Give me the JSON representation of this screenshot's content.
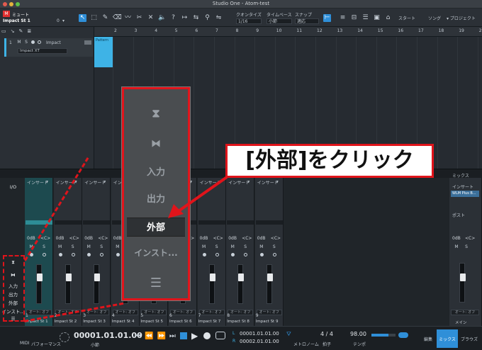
{
  "window": {
    "title": "Studio One - Atom-test"
  },
  "toolbar": {
    "mute_label": "ミュート",
    "track_label": "Impact St 1",
    "track_counter": "0",
    "quantize_label": "クオンタイズ",
    "quantize_value": "1/16",
    "timebase_label": "タイムベース",
    "timebase_value": "小節",
    "snap_label": "スナップ",
    "snap_value": "適応",
    "start_label": "スタート",
    "song_label": "ソング",
    "project_label": "プロジェクト"
  },
  "arrange": {
    "ruler": [
      "2",
      "3",
      "4",
      "5",
      "6",
      "7",
      "8",
      "9",
      "10",
      "11",
      "12",
      "13",
      "14",
      "15",
      "16",
      "17",
      "18",
      "19",
      "20"
    ],
    "track": {
      "number": "1",
      "m": "M",
      "s": "S",
      "name": "Impact",
      "instrument": "Impact XT"
    },
    "pattern_label": "Pattern"
  },
  "leftpanel": {
    "io": "I/O",
    "items": [
      "入力",
      "出力",
      "外部",
      "インスト..."
    ]
  },
  "callout": {
    "items": [
      "入力",
      "出力",
      "外部",
      "インスト..."
    ],
    "label": "[外部]をクリック"
  },
  "mixer": {
    "strips": [
      {
        "insert": "インサート",
        "db": "0dB",
        "pan": "<C>",
        "m": "M",
        "s": "S",
        "auto": "オート: オフ",
        "num": "1",
        "name": "Impact St 1"
      },
      {
        "insert": "インサート",
        "db": "0dB",
        "pan": "<C>",
        "m": "M",
        "s": "S",
        "auto": "オート: オフ",
        "num": "2",
        "name": "Impact St 2"
      },
      {
        "insert": "インサート",
        "db": "0dB",
        "pan": "<C>",
        "m": "M",
        "s": "S",
        "auto": "オート: オフ",
        "num": "3",
        "name": "Impact St 3"
      },
      {
        "insert": "インサート",
        "db": "0dB",
        "pan": "<C>",
        "m": "M",
        "s": "S",
        "auto": "オート: オフ",
        "num": "4",
        "name": "Impact St 4"
      },
      {
        "insert": "インサート",
        "db": "0dB",
        "pan": "<C>",
        "m": "M",
        "s": "S",
        "auto": "オート: オフ",
        "num": "5",
        "name": "Impact St 5"
      },
      {
        "insert": "インサート",
        "db": "0dB",
        "pan": "<C>",
        "m": "M",
        "s": "S",
        "auto": "オート: オフ",
        "num": "6",
        "name": "Impact St 6"
      },
      {
        "insert": "インサート",
        "db": "0dB",
        "pan": "<C>",
        "m": "M",
        "s": "S",
        "auto": "オート: オフ",
        "num": "7",
        "name": "Impact St 7"
      },
      {
        "insert": "インサート",
        "db": "0dB",
        "pan": "<C>",
        "m": "M",
        "s": "S",
        "auto": "オート: オフ",
        "num": "8",
        "name": "Impact St 8"
      },
      {
        "insert": "インサート",
        "db": "0dB",
        "pan": "<C>",
        "m": "M",
        "s": "S",
        "auto": "オート: オフ",
        "num": "9",
        "name": "Impact St 9"
      }
    ],
    "master": {
      "mix_label": "ミックス",
      "insert": "インサート",
      "plugin": "WLM Plus B...",
      "post": "ポスト",
      "db": "0dB",
      "pan": "<C>",
      "m": "M",
      "s": "S",
      "auto": "オート: オフ",
      "name": "メイン"
    }
  },
  "transport": {
    "midi": "MIDI",
    "performance": "パフォーマンス",
    "position": "00001.01.01.00",
    "position_unit": "小節",
    "loop_l": "00001.01.01.00",
    "loop_r": "00002.01.01.00",
    "l_label": "L",
    "r_label": "R",
    "metronome": "メトロノーム",
    "signature": "4 / 4",
    "signature_label": "拍子",
    "tempo": "98.00",
    "tempo_label": "テンポ",
    "tab_edit": "編集",
    "tab_mix": "ミックス",
    "tab_browse": "ブラウズ"
  },
  "colors": {
    "accent": "#2f8fd8",
    "highlight_red": "#e0141b",
    "pattern": "#3eb3e6"
  }
}
